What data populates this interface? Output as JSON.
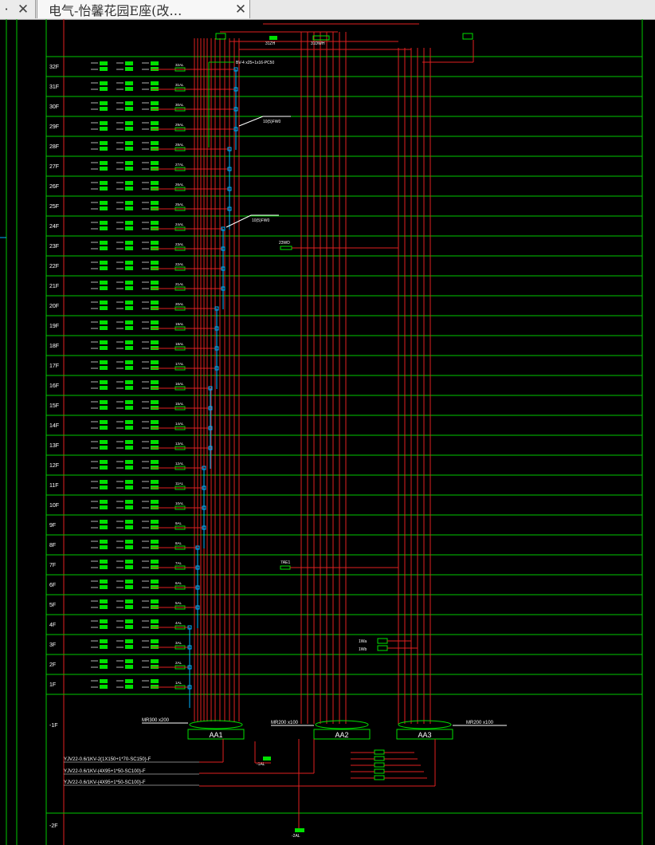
{
  "tabs": [
    {
      "label": "·",
      "close": "✕",
      "icon": "close-icon"
    },
    {
      "label": "电气-怡馨花园E座(改…",
      "close": "✕",
      "icon": "close-icon"
    }
  ],
  "colors": {
    "background": "#000000",
    "floor_line": "#00c800",
    "red_line": "#e02020",
    "box_fill": "#00e000",
    "tap": "#00b4ff",
    "text": "#ffffff"
  },
  "floors": [
    "32F",
    "31F",
    "30F",
    "29F",
    "28F",
    "27F",
    "26F",
    "25F",
    "24F",
    "23F",
    "22F",
    "21F",
    "20F",
    "19F",
    "18F",
    "17F",
    "16F",
    "15F",
    "14F",
    "13F",
    "12F",
    "11F",
    "10F",
    "9F",
    "8F",
    "7F",
    "6F",
    "5F",
    "4F",
    "3F",
    "2F",
    "1F"
  ],
  "basement_floors": [
    "-1F",
    "-2F"
  ],
  "panel_labels": [
    "32AL",
    "31AL",
    "30AL",
    "29AL",
    "28AL",
    "27AL",
    "26AL",
    "25AL",
    "24AL",
    "23AL",
    "22AL",
    "21AL",
    "20AL",
    "19AL",
    "18AL",
    "17AL",
    "16AL",
    "15AL",
    "14AL",
    "13AL",
    "12AL",
    "11AL",
    "10AL",
    "9AL",
    "8AL",
    "7AL",
    "6AL",
    "5AL",
    "4AL",
    "3AL",
    "2AL",
    "1AL"
  ],
  "annotations": {
    "riser_cable": "BV-4 x25+1x16-PC50",
    "tap_box_1": "10(5)FW0",
    "tap_box_2": "10(5)FW0",
    "roof_panel": "31ZH",
    "roof_panel_2": "31DWH",
    "mid_panel": "23WD",
    "floor7_panel": "7AE1",
    "small_panel_1": "1Wa",
    "small_panel_2": "1Wb"
  },
  "distribution": {
    "aa1": "AA1",
    "aa2": "AA2",
    "aa3": "AA3",
    "mr1": "MR300 x200",
    "mr2": "MR200 x100",
    "mr3": "MR200 x100",
    "sub_panel": "-1AL",
    "basement_panel": "-2AL"
  },
  "incoming_cables": [
    "YJV22-0.6/1KV-2(1X150+1*70-SC150)-F",
    "YJV22-0.6/1KV-(4X95+1*50-SC100)-F",
    "YJV22-0.6/1KV-(4X95+1*50-SC100)-F"
  ]
}
